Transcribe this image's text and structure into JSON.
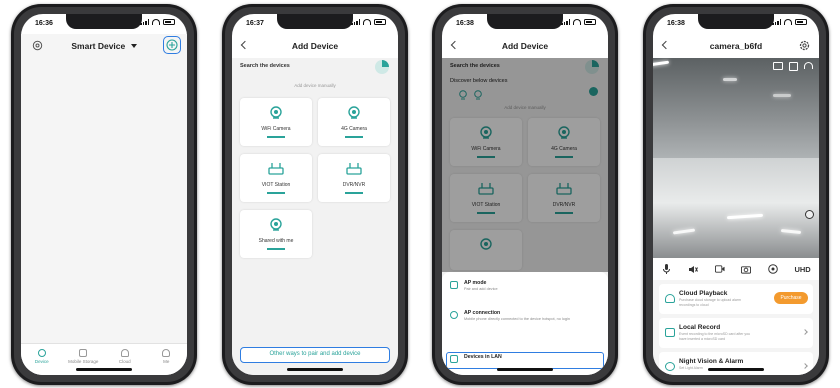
{
  "phone1": {
    "time": "16:36",
    "title": "Smart Device",
    "tabs": [
      "Device",
      "Mobile Storage",
      "Cloud",
      "Me"
    ]
  },
  "phone2": {
    "time": "16:37",
    "title": "Add Device",
    "search_label": "Search the devices",
    "manual_label": "Add device manually",
    "devices": [
      "WiFi Camera",
      "4G Camera",
      "VIOT Station",
      "DVR/NVR",
      "Shared with me"
    ],
    "other_button": "Other ways to pair and add device"
  },
  "phone3": {
    "time": "16:38",
    "title": "Add Device",
    "search_label": "Search the devices",
    "discover_label": "Discover below devices",
    "manual_label": "Add device manually",
    "devices": [
      "WiFi Camera",
      "4G Camera",
      "VIOT Station",
      "DVR/NVR"
    ],
    "options": [
      {
        "title": "AP mode",
        "sub": "Pair and add device"
      },
      {
        "title": "AP connection",
        "sub": "Mobile phone directly connected to the device hotspot, no login"
      },
      {
        "title": "Devices in LAN",
        "sub": ""
      }
    ]
  },
  "phone4": {
    "time": "16:38",
    "title": "camera_b6fd",
    "quality": "UHD",
    "features": [
      {
        "title": "Cloud Playback",
        "sub": "Purchase cloud storage to upload alarm recordings to cloud",
        "action": "Purchase"
      },
      {
        "title": "Local Record",
        "sub": "Event recording to the microSD card after you have inserted a microSD card"
      },
      {
        "title": "Night Vision & Alarm",
        "sub": "Set Light Alarm"
      }
    ]
  },
  "colors": {
    "accent": "#2aa39a",
    "highlight": "#2f7de1",
    "purchase": "#f39a2e"
  }
}
